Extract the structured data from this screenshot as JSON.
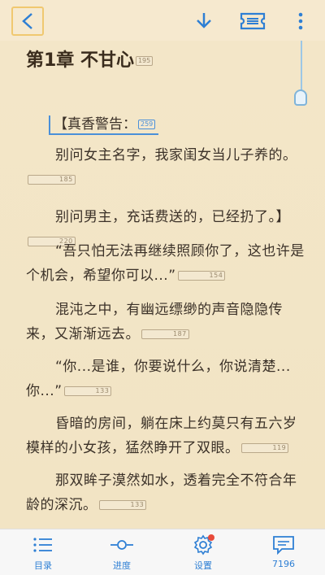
{
  "topbar": {
    "back_label": "<",
    "icons": [
      "back-icon",
      "download-icon",
      "ticket-icon",
      "more-icon"
    ]
  },
  "reader": {
    "chapter_title": "第1章 不甘心",
    "chapter_badge": "195",
    "warning": {
      "text": "【真香警告：",
      "badge": "259"
    },
    "paragraphs": [
      {
        "text": "别问女主名字，我家闺女当儿子养的。",
        "badge": "185"
      },
      {
        "text": "别问男主，充话费送的，已经扔了。】",
        "badge": "220"
      },
      {
        "text": "“吾只怕无法再继续照顾你了，这也许是个机会，希望你可以...”",
        "badge": "154"
      },
      {
        "text": "混沌之中，有幽远缥缈的声音隐隐传来，又渐渐远去。",
        "badge": "187"
      },
      {
        "text": "“你...是谁，你要说什么，你说清楚...你...”",
        "badge": "133"
      },
      {
        "text": "昏暗的房间，躺在床上约莫只有五六岁模样的小女孩，猛然睁开了双眼。",
        "badge": "119"
      },
      {
        "text": "那双眸子漠然如水，透着完全不符合年龄的深沉。",
        "badge": "133"
      }
    ]
  },
  "bottombar": {
    "tabs": [
      {
        "label": "目录",
        "icon": "list-icon"
      },
      {
        "label": "进度",
        "icon": "progress-icon"
      },
      {
        "label": "设置",
        "icon": "settings-icon"
      },
      {
        "label": "7196",
        "icon": "comment-icon"
      }
    ]
  },
  "colors": {
    "accent": "#2e7fd4",
    "paper": "#f3e6c8",
    "text": "#3b3128",
    "notify": "#e84a3a"
  }
}
